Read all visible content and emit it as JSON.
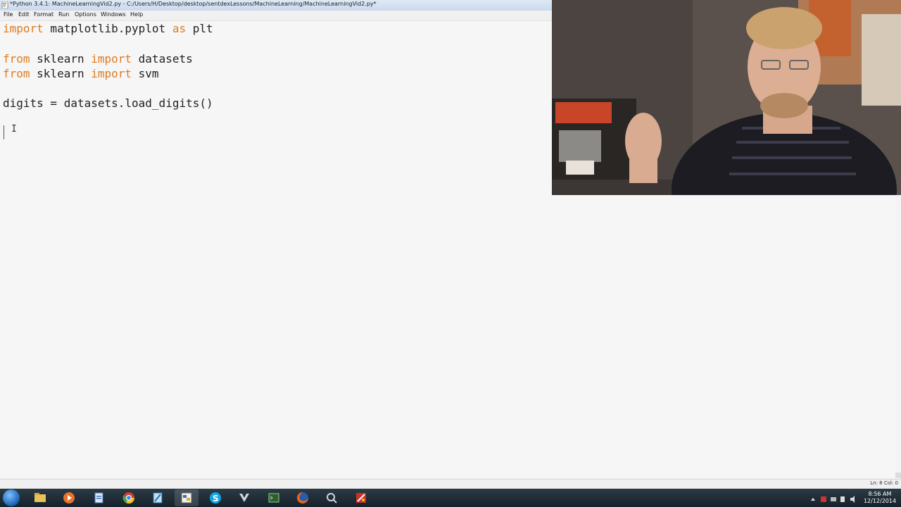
{
  "window": {
    "title": "*Python 3.4.1: MachineLearningVid2.py - C:/Users/H/Desktop/desktop/sentdexLessons/MachineLearning/MachineLearningVid2.py*"
  },
  "menu": {
    "items": [
      "File",
      "Edit",
      "Format",
      "Run",
      "Options",
      "Windows",
      "Help"
    ]
  },
  "editor": {
    "lines": [
      {
        "kw1": "import",
        "t1": " matplotlib.pyplot ",
        "kw2": "as",
        "t2": " plt"
      },
      {
        "kw1": "from",
        "t1": " sklearn ",
        "kw2": "import",
        "t2": " datasets"
      },
      {
        "kw1": "from",
        "t1": " sklearn ",
        "kw2": "import",
        "t2": " svm"
      },
      {
        "text": "digits = datasets.load_digits()"
      }
    ]
  },
  "status": {
    "position": "Ln: 8 Col: 0"
  },
  "taskbar": {
    "apps": [
      "windows-explorer",
      "media-player",
      "file-manager",
      "chrome",
      "notepad",
      "python-idle",
      "skype",
      "winamp",
      "terminal",
      "firefox",
      "search",
      "paint"
    ],
    "clock_time": "8:56 AM",
    "clock_date": "12/12/2014"
  },
  "colors": {
    "keyword": "#e07a1f",
    "editor_bg": "#f6f6f6",
    "taskbar_bg": "#1c2a33"
  }
}
